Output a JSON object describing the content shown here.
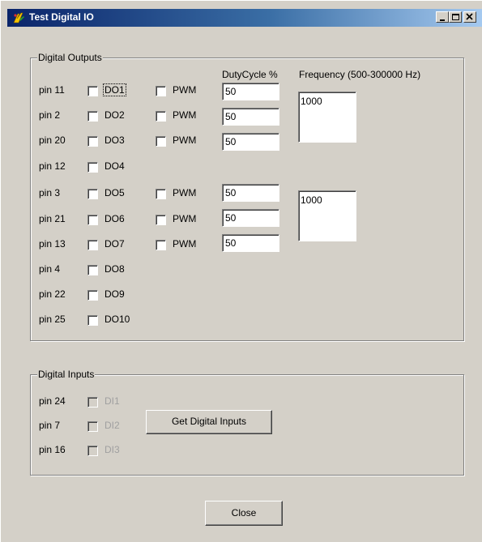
{
  "window": {
    "title": "Test Digital IO",
    "icon": "app-icon"
  },
  "outputs": {
    "legend": "Digital Outputs",
    "duty_header": "DutyCycle %",
    "freq_header": "Frequency (500-300000 Hz)",
    "pwm_label": "PWM",
    "rows": [
      {
        "pin": "pin 11",
        "do": "DO1"
      },
      {
        "pin": "pin 2",
        "do": "DO2"
      },
      {
        "pin": "pin 20",
        "do": "DO3"
      },
      {
        "pin": "pin 12",
        "do": "DO4"
      },
      {
        "pin": "pin 3",
        "do": "DO5"
      },
      {
        "pin": "pin 21",
        "do": "DO6"
      },
      {
        "pin": "pin 13",
        "do": "DO7"
      },
      {
        "pin": "pin 4",
        "do": "DO8"
      },
      {
        "pin": "pin 22",
        "do": "DO9"
      },
      {
        "pin": "pin 25",
        "do": "DO10"
      }
    ],
    "duty": [
      "50",
      "50",
      "50",
      "50",
      "50",
      "50"
    ],
    "freq": [
      "1000",
      "1000"
    ]
  },
  "inputs": {
    "legend": "Digital Inputs",
    "rows": [
      {
        "pin": "pin 24",
        "di": "DI1"
      },
      {
        "pin": "pin 7",
        "di": "DI2"
      },
      {
        "pin": "pin 16",
        "di": "DI3"
      }
    ],
    "get_button": "Get Digital Inputs"
  },
  "footer": {
    "close_button": "Close"
  },
  "colors": {
    "face": "#d4d0c8",
    "title_start": "#0a246a",
    "title_end": "#a6caf0",
    "disabled_text": "#a0a0a0"
  }
}
